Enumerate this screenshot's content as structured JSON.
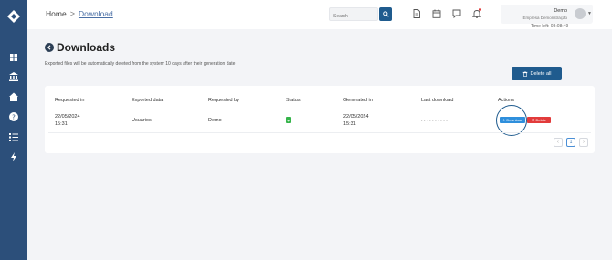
{
  "header": {
    "breadcrumb": {
      "home": "Home",
      "separator": ">",
      "current": "Download"
    },
    "search": {
      "placeholder": "Search"
    },
    "user": {
      "name": "Demo",
      "company": "Empresa Demonstração"
    },
    "time_left": "Time left: 08:08:49"
  },
  "page": {
    "title": "Downloads",
    "info": "Exported files will be automatically deleted from the system 10 days after their generation date",
    "delete_all_label": "Delete all"
  },
  "table": {
    "columns": [
      "Requested in",
      "Exported data",
      "Requested by",
      "Status",
      "Generated in",
      "Last download",
      "Actions"
    ],
    "rows": [
      {
        "requested_date": "22/05/2024",
        "requested_time": "15:31",
        "exported_data": "Usuários",
        "requested_by": "Demo",
        "generated_date": "22/05/2024",
        "generated_time": "15:31",
        "last_download": "- - - - - - - - - -",
        "download_label": "Download",
        "delete_label": "Delete"
      }
    ]
  },
  "pagination": {
    "prev": "‹",
    "current_page": "1",
    "next": "›"
  },
  "colors": {
    "sidebar": "#2c4f7a",
    "primary": "#1f5b8e",
    "download": "#2f8fdc",
    "delete": "#e23b3b",
    "status_ok": "#35b44a"
  },
  "icons": {
    "sidebar": [
      "grid-icon",
      "bank-icon",
      "home-icon",
      "help-icon",
      "checklist-icon",
      "lightning-icon"
    ],
    "header": [
      "document-icon",
      "calendar-icon",
      "chat-icon",
      "bell-icon"
    ]
  }
}
